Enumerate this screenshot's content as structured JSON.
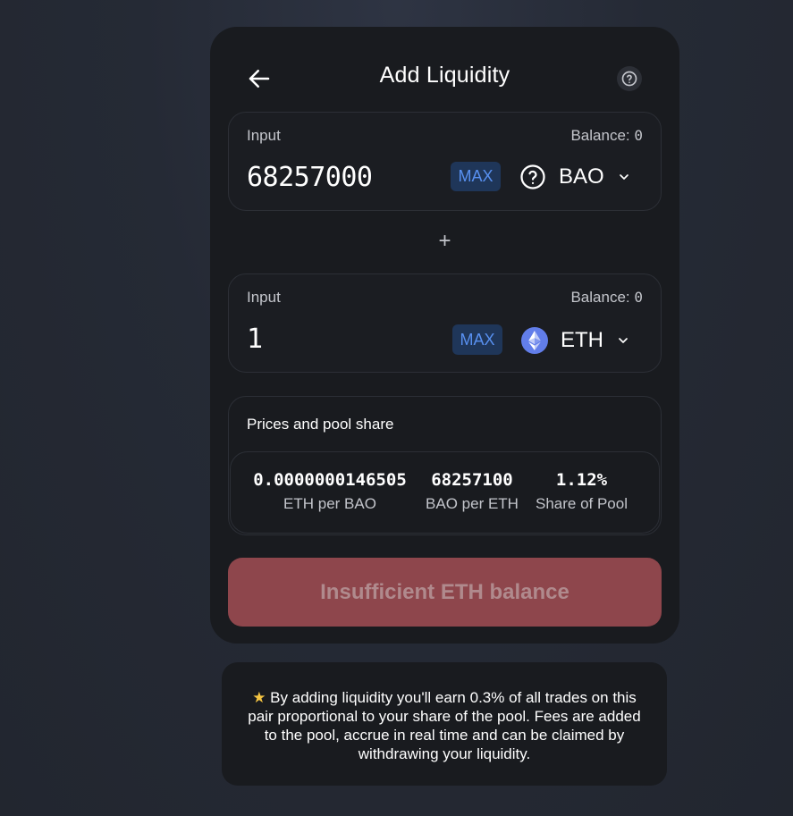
{
  "header": {
    "title": "Add Liquidity",
    "back_icon": "arrow-left-icon",
    "help_icon": "question-circle-icon"
  },
  "input_a": {
    "label": "Input",
    "balance_label": "Balance: ",
    "balance_value": "0",
    "amount": "68257000",
    "max_label": "MAX",
    "token_symbol": "BAO",
    "token_icon": "question-circle-icon"
  },
  "plus_sign": "+",
  "input_b": {
    "label": "Input",
    "balance_label": "Balance: ",
    "balance_value": "0",
    "amount": "1",
    "max_label": "MAX",
    "token_symbol": "ETH",
    "token_icon": "ethereum-icon"
  },
  "prices": {
    "title": "Prices and pool share",
    "stats": [
      {
        "value": "0.0000000146505",
        "label": "ETH per BAO"
      },
      {
        "value": "68257100",
        "label": "BAO per ETH"
      },
      {
        "value": "1.12%",
        "label": "Share of Pool"
      }
    ]
  },
  "submit": {
    "label": "Insufficient ETH balance"
  },
  "note": {
    "star": "★",
    "text_before": " By adding liquidity you'll earn ",
    "fee": "0.3%",
    "text_after": " of all trades on this pair proportional to your share of the pool. Fees are added to the pool, accrue in real time and can be claimed by withdrawing your liquidity."
  },
  "colors": {
    "accent_blue": "#5890f0",
    "max_bg": "#1f3659",
    "error_button": "#8e464c",
    "card_bg": "#191b1f",
    "eth_icon": "#627eea"
  }
}
